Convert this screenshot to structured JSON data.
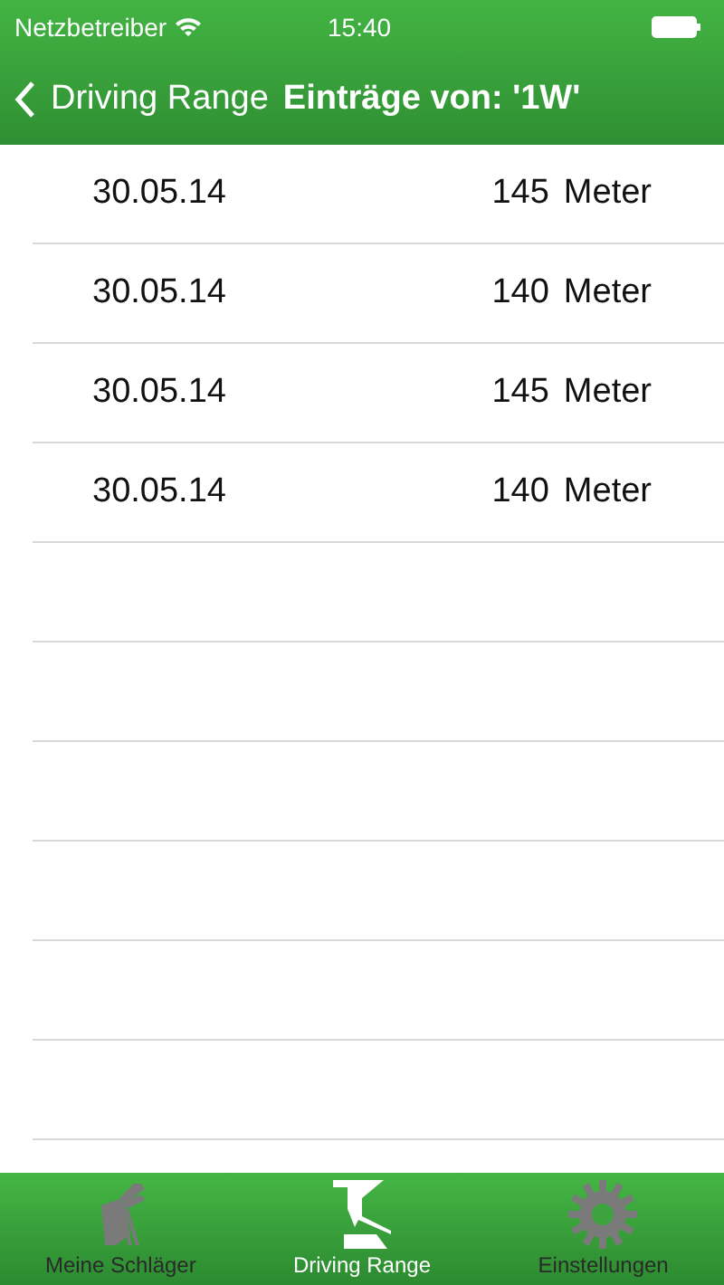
{
  "status_bar": {
    "carrier": "Netzbetreiber",
    "time": "15:40"
  },
  "nav": {
    "back": "Driving Range",
    "title": "Einträge von: '1W'"
  },
  "entries": [
    {
      "date": "30.05.14",
      "distance": "145",
      "unit": "Meter"
    },
    {
      "date": "30.05.14",
      "distance": "140",
      "unit": "Meter"
    },
    {
      "date": "30.05.14",
      "distance": "145",
      "unit": "Meter"
    },
    {
      "date": "30.05.14",
      "distance": "140",
      "unit": "Meter"
    }
  ],
  "tabs": [
    {
      "label": "Meine Schläger",
      "kind": "bag",
      "selected": false
    },
    {
      "label": "Driving Range",
      "kind": "range",
      "selected": true
    },
    {
      "label": "Einstellungen",
      "kind": "gear",
      "selected": false
    }
  ]
}
